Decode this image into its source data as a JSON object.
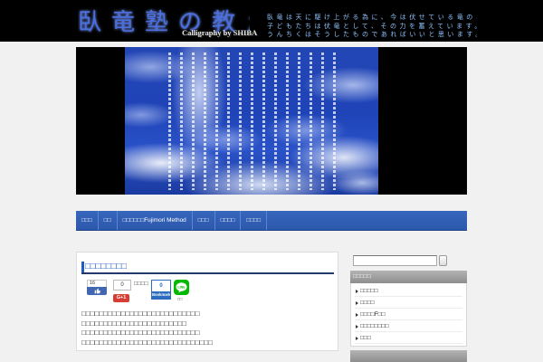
{
  "header": {
    "logo_text": "臥竜塾の教え",
    "logo_credit": "Calligraphy by SHIBA",
    "tagline": [
      "臥竜は天に駆け上がる為に、今は伏せている竜のごとく、",
      "子どもたちは伏竜として、その力を蓄えています。",
      "うんちくはそうしたものであればいいと思います。（藤森平司）"
    ]
  },
  "nav": {
    "items": [
      "□□□",
      "□□",
      "□□□□□□Fujimori Method",
      "□□□",
      "□□□□",
      "□□□□"
    ]
  },
  "post": {
    "title": "□□□□□□□□",
    "social": {
      "facebook_count": "16",
      "gplus_count": "0",
      "gplus_label": "G+1",
      "tweet_label": "□□□□",
      "hatena_count": "0",
      "hatena_label": "Bookmark",
      "line_logo_text": "LINE",
      "line_label": "□□"
    },
    "body_lines": [
      "□□□□□□□□□□□□□□□□□□□□□□□□□□□",
      "□□□□□□□□□□□□□□□□□□□□□□□□",
      "□□□□□□□□□□□□□□□□□□□□□□□□□□□",
      "□□□□□□□□□□□□□□□□□□□□□□□□□□□□□□"
    ]
  },
  "sidebar": {
    "categories_widget": {
      "title": "□□□□□",
      "items": [
        "□□□□□",
        "□□□□",
        "□□□□F□□",
        "□□□□□□□□",
        "□□□"
      ]
    }
  },
  "icons": {
    "facebook_like": "thumbs-up-icon",
    "line": "line-icon",
    "list_bullet": "triangle-bullet-icon"
  },
  "colors": {
    "header_bg": "#000000",
    "nav_bg": "#2c5aad",
    "accent": "#1f5bc4",
    "tagline": "#8fc3ff",
    "facebook": "#4267b2",
    "gplus": "#d73d32",
    "hatena": "#2c6ebd",
    "line": "#00b900"
  }
}
